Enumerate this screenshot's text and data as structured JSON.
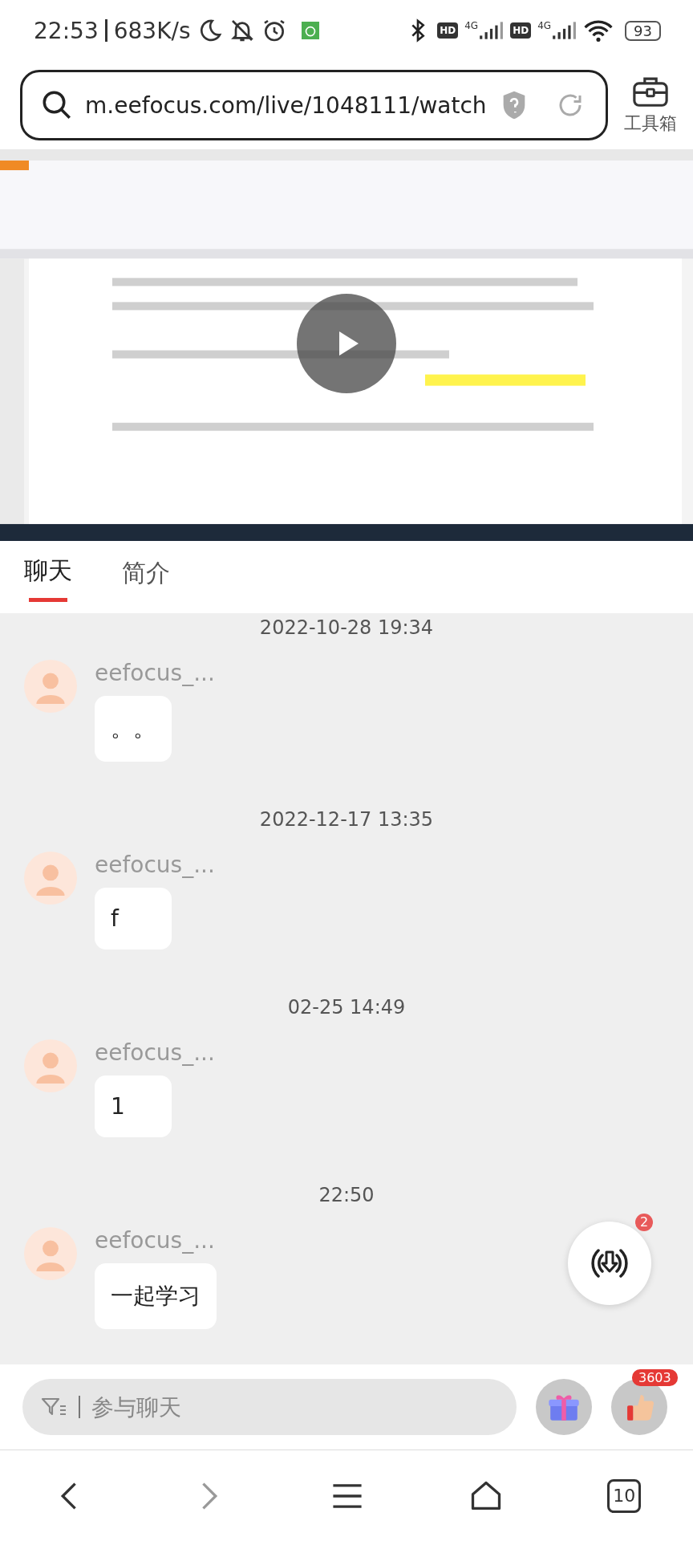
{
  "status_bar": {
    "time": "22:53",
    "speed": "683K/s",
    "networks": [
      {
        "hd": "HD",
        "type": "4G"
      },
      {
        "hd": "HD",
        "type": "4G"
      }
    ],
    "battery": "93"
  },
  "address_bar": {
    "url": "m.eefocus.com/live/1048111/watch",
    "toolbox_label": "工具箱"
  },
  "tabs": [
    {
      "label": "聊天",
      "selected": true
    },
    {
      "label": "简介",
      "selected": false
    }
  ],
  "chat": [
    {
      "kind": "time",
      "text": "2022-10-28 19:34"
    },
    {
      "kind": "message",
      "name": "eefocus_...",
      "text": "。。"
    },
    {
      "kind": "time",
      "text": "2022-12-17 13:35"
    },
    {
      "kind": "message",
      "name": "eefocus_...",
      "text": "f"
    },
    {
      "kind": "time",
      "text": "02-25 14:49"
    },
    {
      "kind": "message",
      "name": "eefocus_...",
      "text": "1"
    },
    {
      "kind": "time",
      "text": "22:50"
    },
    {
      "kind": "message",
      "name": "eefocus_...",
      "text": "一起学习"
    }
  ],
  "new_messages_badge": "2",
  "input": {
    "placeholder": "参与聊天"
  },
  "like_count": "3603",
  "nav": {
    "tab_count": "10"
  }
}
